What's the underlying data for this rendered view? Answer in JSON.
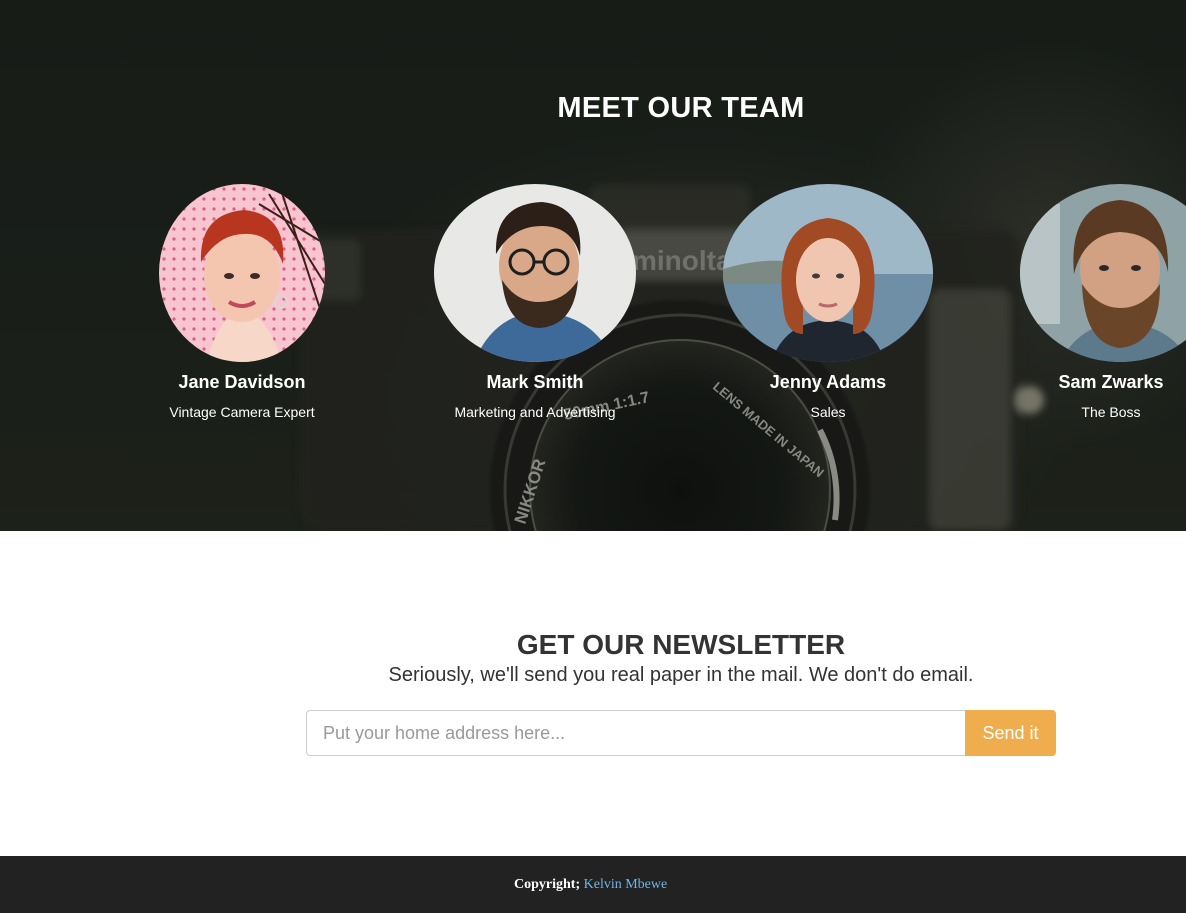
{
  "team": {
    "title": "MEET OUR TEAM",
    "members": [
      {
        "name": "Jane Davidson",
        "role": "Vintage Camera Expert"
      },
      {
        "name": "Mark Smith",
        "role": "Marketing and Advertising"
      },
      {
        "name": "Jenny Adams",
        "role": "Sales"
      },
      {
        "name": "Sam Zwarks",
        "role": "The Boss"
      }
    ],
    "background_text": {
      "lens_text": "LENS MADE IN JAPAN",
      "focal": "50mm 1:1.7",
      "brand": "NIKKOR",
      "maker": "minolta"
    }
  },
  "newsletter": {
    "title": "GET OUR NEWSLETTER",
    "subtitle": "Seriously, we'll send you real paper in the mail. We don't do email.",
    "input_placeholder": "Put your home address here...",
    "button_label": "Send it"
  },
  "footer": {
    "copyright_label": "Copyright;",
    "author_link": "Kelvin Mbewe"
  },
  "colors": {
    "accent": "#f0ad4e",
    "footer_bg": "#222222",
    "link": "#6cb8e6",
    "heading": "#333333"
  }
}
